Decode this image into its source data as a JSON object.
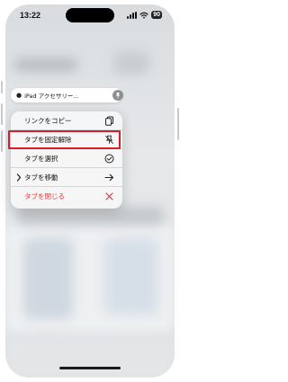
{
  "status_bar": {
    "time": "13:22",
    "battery": "90"
  },
  "pinned_tab": {
    "title": "iPad アクセサリー…"
  },
  "menu": {
    "items": [
      {
        "label": "リンクをコピー",
        "icon": "copy-icon"
      },
      {
        "label": "タブを固定解除",
        "icon": "unpin-icon"
      },
      {
        "label": "タブを選択",
        "icon": "checkmark-circle-icon"
      },
      {
        "label": "タブを移動",
        "icon": "arrow-right-icon"
      },
      {
        "label": "タブを閉じる",
        "icon": "close-icon"
      }
    ]
  },
  "colors": {
    "highlight": "#d21f2a",
    "danger": "#e53935",
    "accent": "#007aff"
  }
}
